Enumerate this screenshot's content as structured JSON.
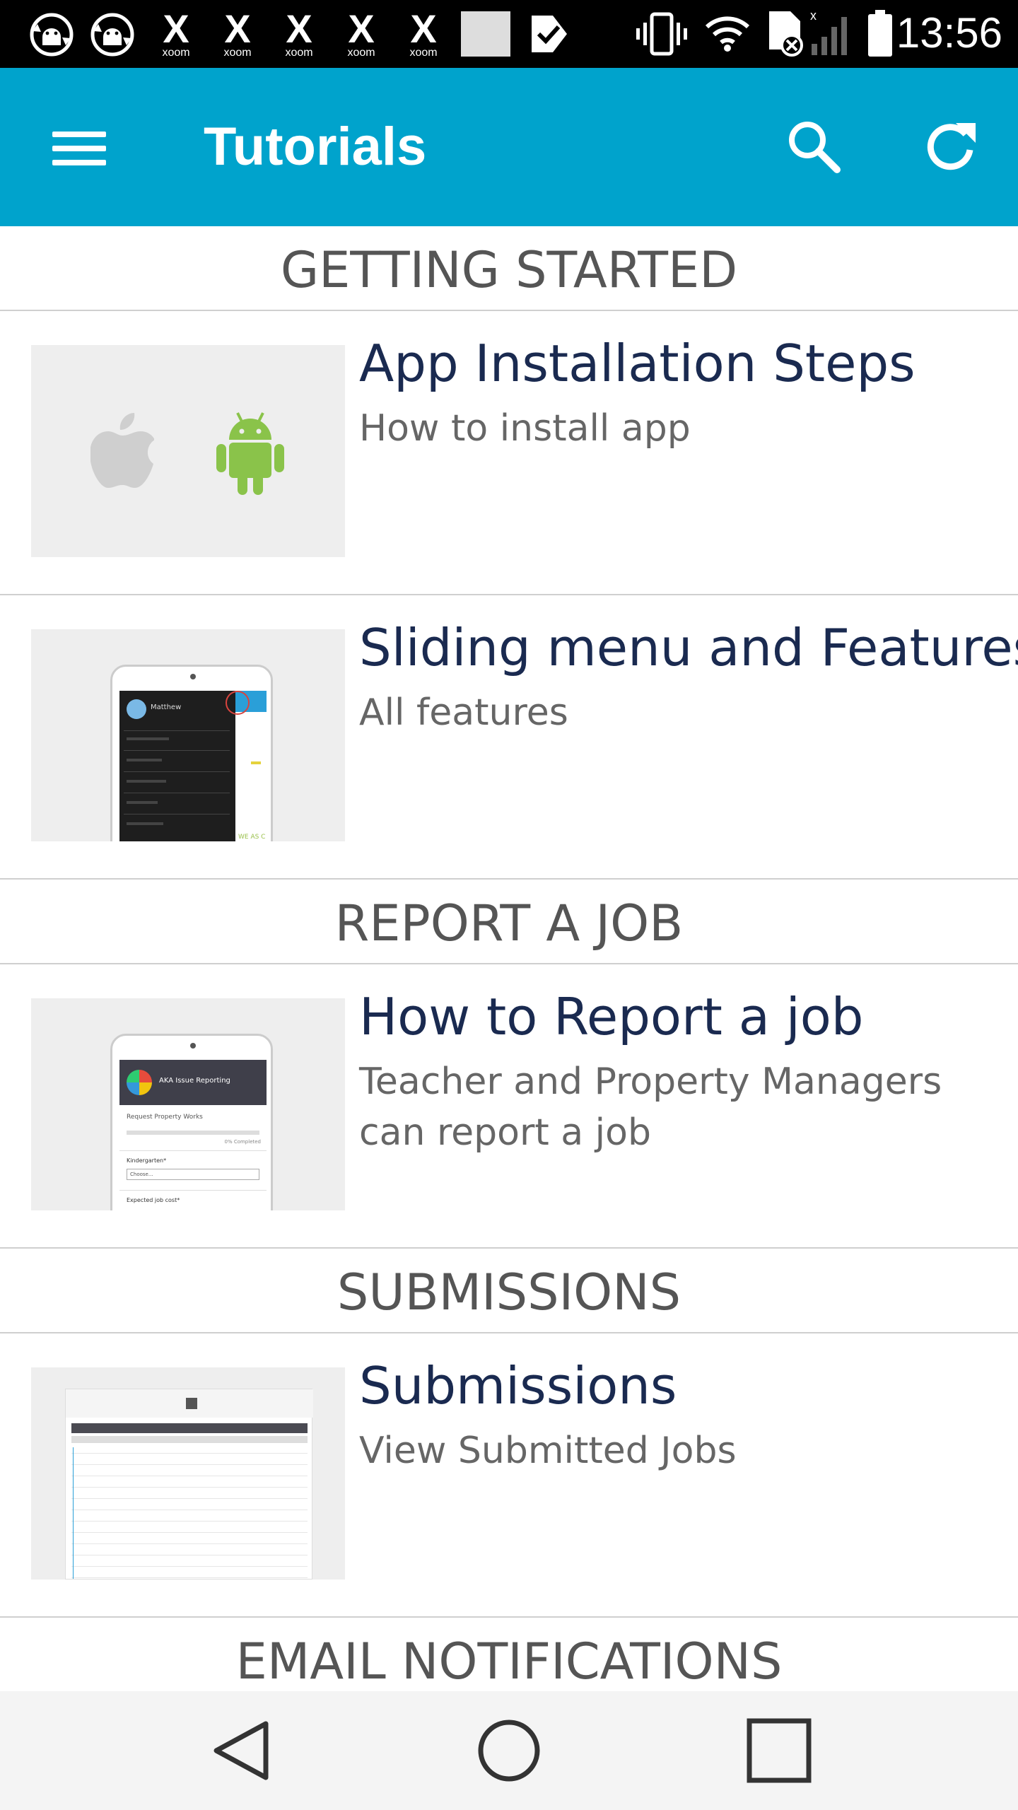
{
  "status_bar": {
    "time": "13:56",
    "notification_icons": [
      "android-sync-icon",
      "android-sync-icon",
      "xoom-icon",
      "xoom-icon",
      "xoom-icon",
      "xoom-icon",
      "xoom-icon",
      "blank-notification-icon",
      "task-check-icon"
    ],
    "xoom_label": "xoom",
    "system_icons": [
      "vibrate-icon",
      "wifi-icon",
      "sd-card-error-icon",
      "signal-icon",
      "battery-icon"
    ]
  },
  "app_bar": {
    "title": "Tutorials",
    "color": "#00a3cc",
    "icons": [
      "menu-icon",
      "search-icon",
      "refresh-icon"
    ]
  },
  "sections": [
    {
      "header": "GETTING STARTED",
      "items": [
        {
          "title": "App Installation Steps",
          "subtitle": "How to install app",
          "thumb": "apple-android-logos"
        },
        {
          "title": "Sliding menu and Features",
          "subtitle": "All features",
          "thumb": "sliding-menu-screenshot"
        }
      ]
    },
    {
      "header": "REPORT A JOB",
      "items": [
        {
          "title": "How to Report a job",
          "subtitle": "Teacher and Property Managers can report a job",
          "thumb": "report-job-screenshot"
        }
      ]
    },
    {
      "header": "SUBMISSIONS",
      "items": [
        {
          "title": "Submissions",
          "subtitle": "View Submitted Jobs",
          "thumb": "submissions-table-screenshot"
        }
      ]
    },
    {
      "header": "EMAIL NOTIFICATIONS",
      "items": []
    }
  ],
  "thumbnails": {
    "sliding_menu": {
      "user_name": "Matthew",
      "tagline": "WE AS C"
    },
    "report_job": {
      "header": "AKA Issue Reporting",
      "form_title": "Request Property Works",
      "progress": "0% Completed",
      "field1": "Kindergarten*",
      "select": "Choose...",
      "field2": "Expected job cost*"
    }
  },
  "nav_bar": {
    "icons": [
      "back-icon",
      "home-icon",
      "recents-icon"
    ]
  }
}
